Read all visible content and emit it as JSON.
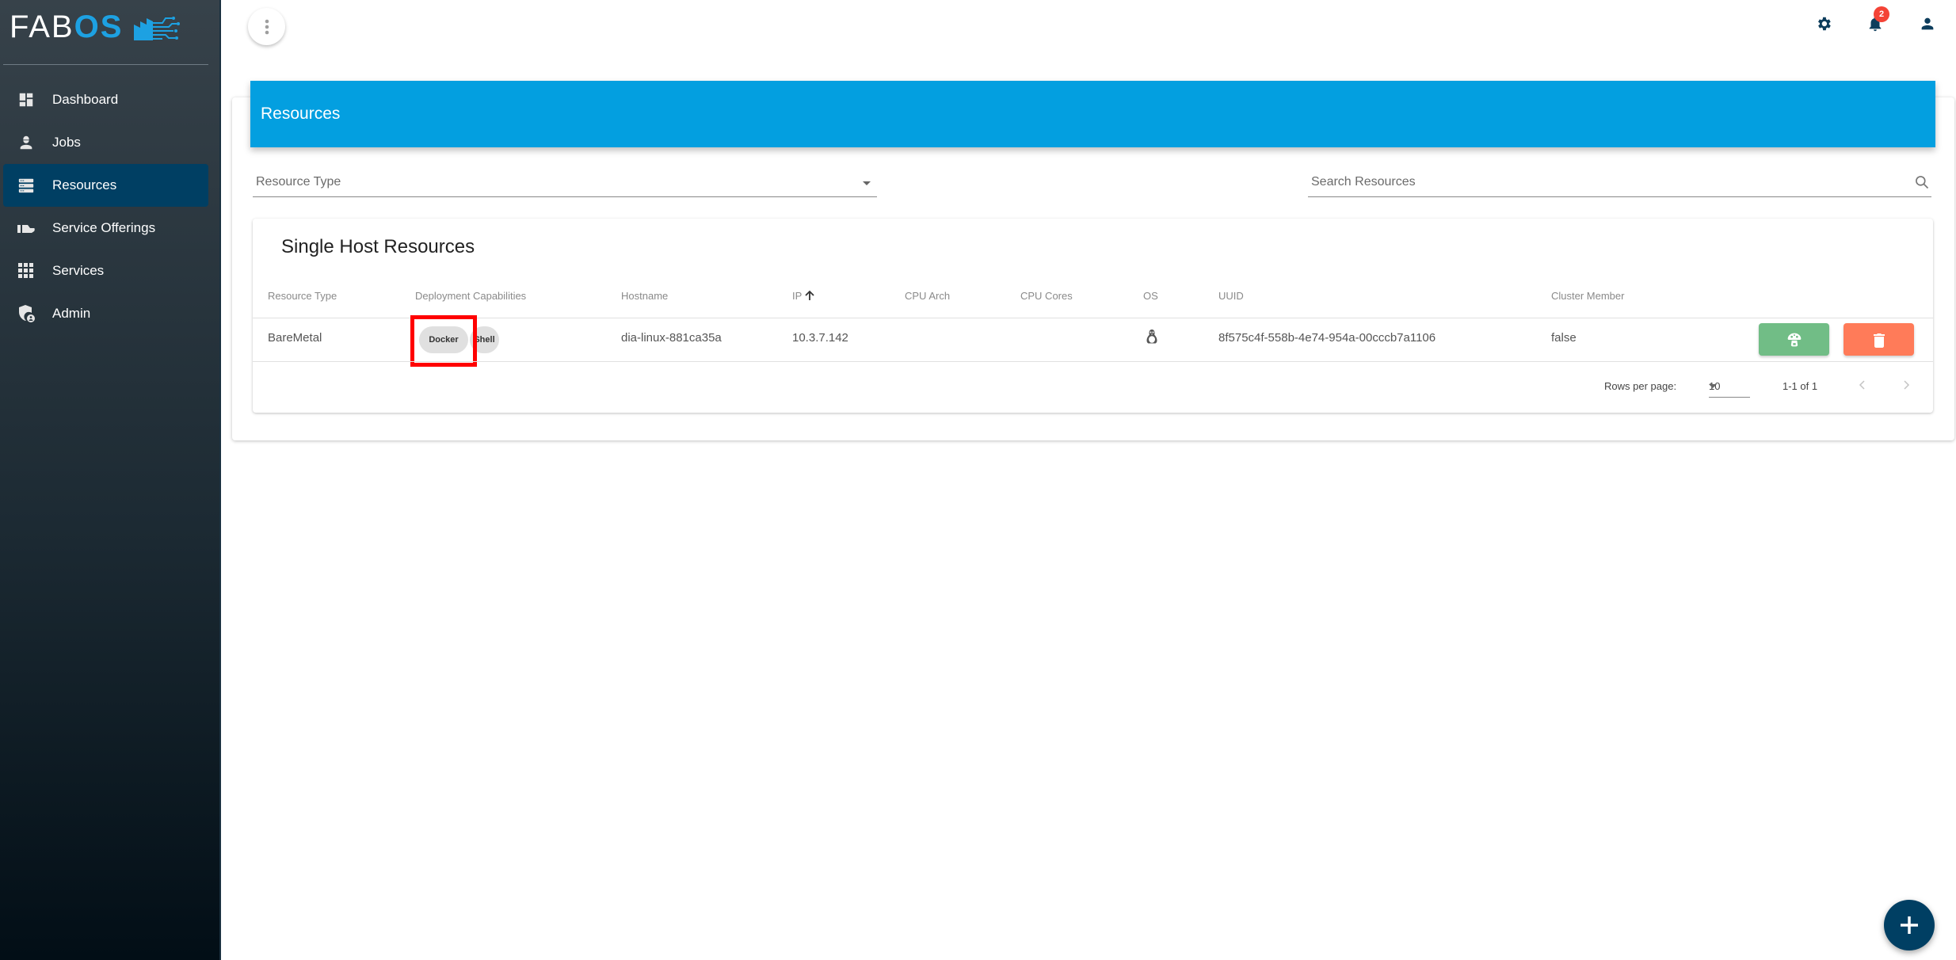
{
  "app": {
    "logo_text_a": "FAB",
    "logo_text_b": "OS",
    "brand_color": "#1da1e2"
  },
  "sidebar": {
    "items": [
      {
        "label": "Dashboard",
        "icon": "dashboard-icon",
        "active": false
      },
      {
        "label": "Jobs",
        "icon": "worker-icon",
        "active": false
      },
      {
        "label": "Resources",
        "icon": "server-icon",
        "active": true
      },
      {
        "label": "Service Offerings",
        "icon": "hand-offering-icon",
        "active": false
      },
      {
        "label": "Services",
        "icon": "apps-grid-icon",
        "active": false
      },
      {
        "label": "Admin",
        "icon": "admin-shield-icon",
        "active": false
      }
    ],
    "active_color": "#003f63"
  },
  "topbar": {
    "menu_icon": "more-vert-icon",
    "notification_count": "2",
    "icons": [
      "gear-icon",
      "bell-icon",
      "account-icon"
    ]
  },
  "page": {
    "title": "Resources",
    "banner_color": "#039fe0"
  },
  "filters": {
    "resource_type_label": "Resource Type",
    "resource_type_value": "",
    "search_placeholder": "Search Resources",
    "search_value": ""
  },
  "table": {
    "title": "Single Host Resources",
    "columns": [
      "Resource Type",
      "Deployment Capabilities",
      "Hostname",
      "IP",
      "CPU Arch",
      "CPU Cores",
      "OS",
      "UUID",
      "Cluster Member"
    ],
    "sort": {
      "column": "IP",
      "direction": "asc"
    },
    "rows": [
      {
        "resource_type": "BareMetal",
        "capabilities": [
          "Docker",
          "Shell"
        ],
        "hostname": "dia-linux-881ca35a",
        "ip": "10.3.7.142",
        "cpu_arch": "",
        "cpu_cores": "",
        "os": "linux-icon",
        "uuid": "8f575c4f-558b-4e74-954a-00cccb7a1106",
        "cluster_member": "false",
        "actions": [
          {
            "name": "deploy",
            "icon": "mushroom-icon",
            "color": "#71bd86"
          },
          {
            "name": "delete",
            "icon": "trash-icon",
            "color": "#ff7b59"
          }
        ]
      }
    ],
    "pagination": {
      "rows_per_page_label": "Rows per page:",
      "rows_per_page": "10",
      "range": "1-1 of 1"
    }
  },
  "fab": {
    "icon": "plus-icon",
    "color": "#003f63"
  }
}
